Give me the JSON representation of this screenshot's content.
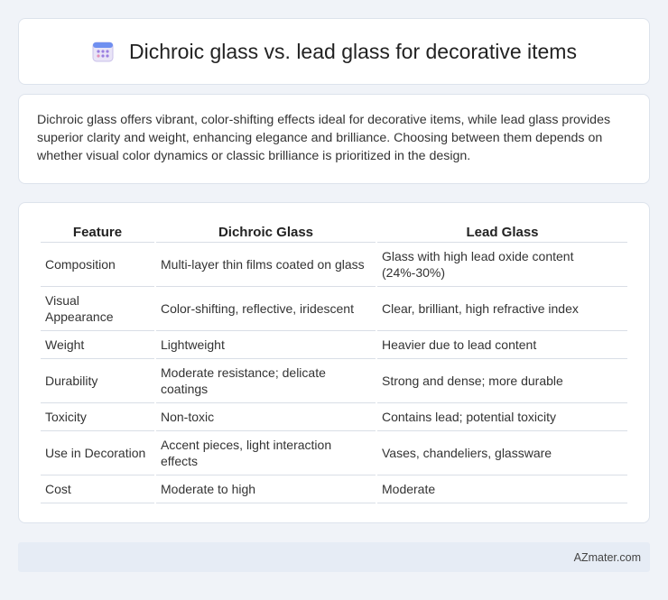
{
  "header": {
    "icon": "calendar-icon",
    "title": "Dichroic glass vs. lead glass for decorative items"
  },
  "intro": {
    "text": "Dichroic glass offers vibrant, color-shifting effects ideal for decorative items, while lead glass provides superior clarity and weight, enhancing elegance and brilliance. Choosing between them depends on whether visual color dynamics or classic brilliance is prioritized in the design."
  },
  "table": {
    "headers": [
      "Feature",
      "Dichroic Glass",
      "Lead Glass"
    ],
    "rows": [
      [
        "Composition",
        "Multi-layer thin films coated on glass",
        "Glass with high lead oxide content (24%-30%)"
      ],
      [
        "Visual Appearance",
        "Color-shifting, reflective, iridescent",
        "Clear, brilliant, high refractive index"
      ],
      [
        "Weight",
        "Lightweight",
        "Heavier due to lead content"
      ],
      [
        "Durability",
        "Moderate resistance; delicate coatings",
        "Strong and dense; more durable"
      ],
      [
        "Toxicity",
        "Non-toxic",
        "Contains lead; potential toxicity"
      ],
      [
        "Use in Decoration",
        "Accent pieces, light interaction effects",
        "Vases, chandeliers, glassware"
      ],
      [
        "Cost",
        "Moderate to high",
        "Moderate"
      ]
    ]
  },
  "footer": {
    "text": "AZmater.com"
  }
}
